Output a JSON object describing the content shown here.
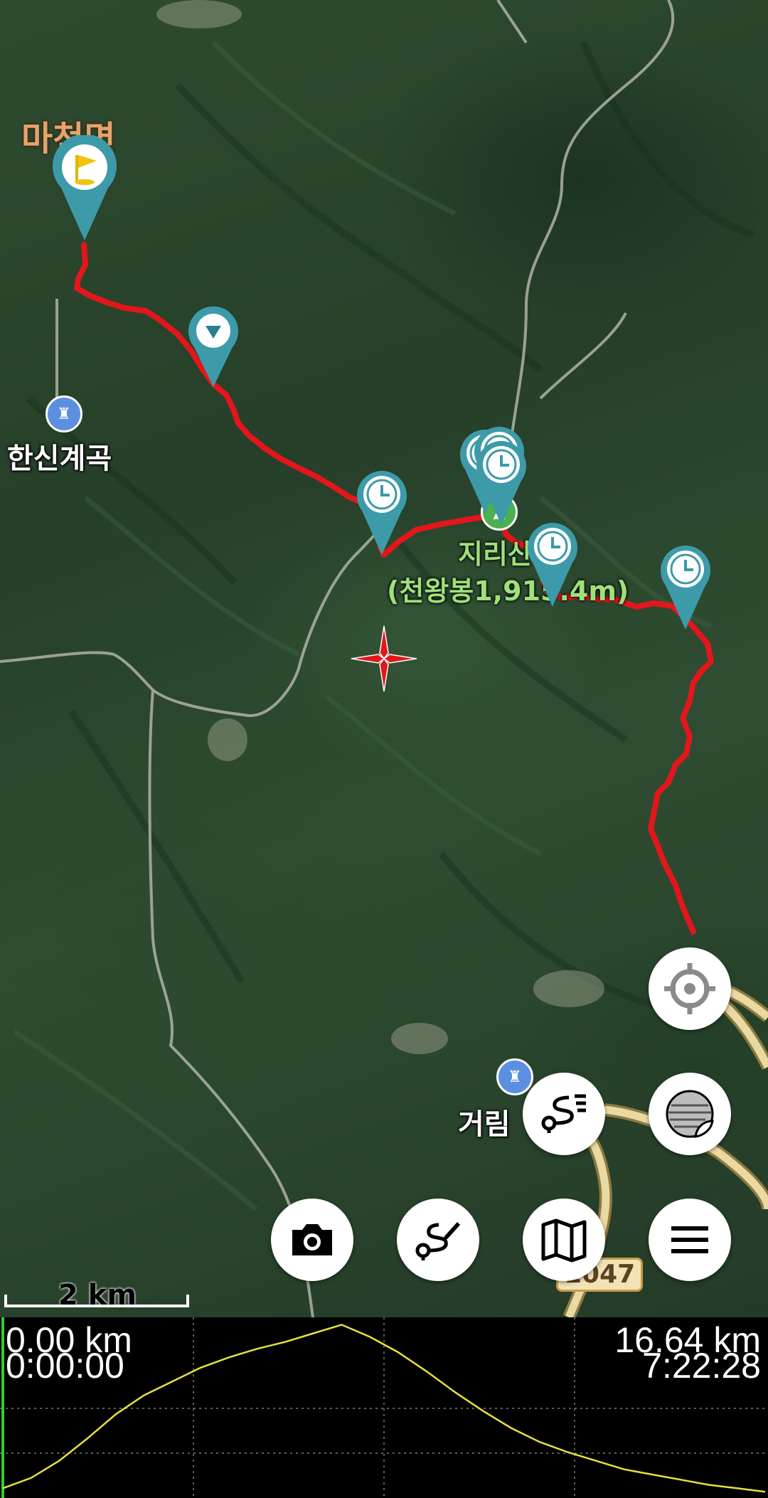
{
  "map": {
    "labels": {
      "township": "마천면",
      "valley": "한신계곡",
      "peak_name": "지리산",
      "peak_sub": "(천왕봉1,915.4m)",
      "lower_place": "거림"
    },
    "road_number": "1047",
    "scale_label": "2 km",
    "colors": {
      "track": "#e3161c",
      "marker": "#3d9aa9",
      "crosshair": "#e3161c",
      "elevation_line": "#e6e13c"
    },
    "markers": [
      "start-flag-marker",
      "direction-marker",
      "time-marker",
      "time-marker",
      "time-marker",
      "time-marker",
      "time-marker"
    ]
  },
  "buttons": {
    "locate": "crosshair-icon",
    "layers": "layers-icon",
    "route_list": "route-list-icon",
    "camera": "camera-icon",
    "draw_route": "route-edit-icon",
    "map_select": "map-icon",
    "menu": "menu-icon"
  },
  "elevation_profile": {
    "start_distance": "0.00 km",
    "start_time": "0:00:00",
    "end_distance": "16.64 km",
    "end_time": "7:22:28",
    "total_km": 16.64,
    "profile": [
      0.04,
      0.1,
      0.2,
      0.33,
      0.47,
      0.58,
      0.66,
      0.74,
      0.8,
      0.85,
      0.89,
      0.94,
      0.99,
      0.92,
      0.83,
      0.72,
      0.6,
      0.49,
      0.39,
      0.31,
      0.25,
      0.2,
      0.15,
      0.12,
      0.09,
      0.06,
      0.04,
      0.02
    ]
  }
}
